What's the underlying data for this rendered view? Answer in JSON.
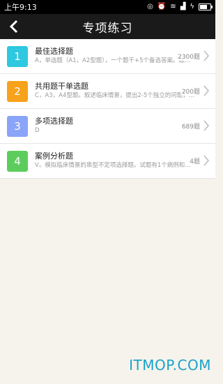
{
  "status": {
    "time": "上午9:13"
  },
  "nav": {
    "title": "专项练习"
  },
  "items": [
    {
      "num": "1",
      "name": "最佳选择题",
      "desc": "A，单选题（A1，A2型题），一个题干+5个备选答案。题…",
      "count": "2300题",
      "color": "#2ec8e0"
    },
    {
      "num": "2",
      "name": "共用题干单选题",
      "desc": "C，A3，A4型题。叙述临床情景，提出2-5个独立的问题，…",
      "count": "200题",
      "color": "#f7a21b"
    },
    {
      "num": "3",
      "name": "多项选择题",
      "desc": "D",
      "count": "689题",
      "color": "#8aa4f7"
    },
    {
      "num": "4",
      "name": "案例分析题",
      "desc": "V。模拟临床情景的串型不定项选择题。试题有1个病例和…",
      "count": "4题",
      "color": "#5ccd5c"
    }
  ],
  "watermark": "ITMOP.COM"
}
